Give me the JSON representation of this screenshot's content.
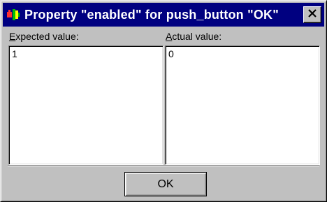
{
  "window": {
    "title": "Property \"enabled\" for push_button \"OK\"",
    "app_icon": "app-icon",
    "close_icon": "close-icon"
  },
  "expected": {
    "label_mnemonic": "E",
    "label_rest": "xpected value:",
    "value": "1"
  },
  "actual": {
    "label_mnemonic": "A",
    "label_rest": "ctual value:",
    "value": "0"
  },
  "buttons": {
    "ok_label": "OK"
  },
  "colors": {
    "titlebar": "#000080",
    "face": "#c0c0c0"
  }
}
